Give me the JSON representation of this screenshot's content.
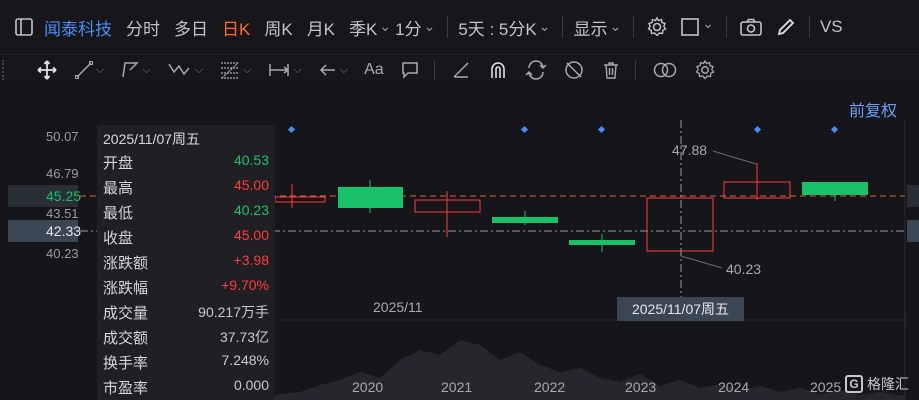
{
  "toolbar": {
    "stock_name": "闻泰科技",
    "periods": [
      "分时",
      "多日",
      "日K",
      "周K",
      "月K",
      "季K"
    ],
    "active_period": "日K",
    "interval": "1分",
    "multi_day": "5天 : 5分K",
    "display": "显示",
    "vs": "VS"
  },
  "drawbar": {
    "text_tool": "Aa",
    "icons": [
      "move-icon",
      "line-icon",
      "polyline-icon",
      "wave-icon",
      "fib-icon",
      "range-icon",
      "arrow-icon",
      "text-icon",
      "comment-icon",
      "ruler-icon",
      "magnet-icon",
      "sync-icon",
      "hide-icon",
      "trash-icon",
      "compare-icon",
      "settings-icon"
    ]
  },
  "chart": {
    "restore_label": "前复权",
    "y_labels": [
      "50.07",
      "46.79",
      "43.51",
      "40.23"
    ],
    "price_tag_current": "45.25",
    "price_tag_cross": "42.33",
    "high_marker": "47.88",
    "low_marker": "40.23",
    "x_labels": [
      "2025/11",
      "2020",
      "2021",
      "2022",
      "2023",
      "2024",
      "2025"
    ],
    "cross_date": "2025/11/07周五",
    "colors": {
      "up": "#ff3b3b",
      "down": "#17c26b",
      "accent": "#ff6a2a",
      "link": "#4a8cf0"
    }
  },
  "info": {
    "date": "2025/11/07周五",
    "rows": [
      {
        "k": "开盘",
        "v": "40.53",
        "c": "green"
      },
      {
        "k": "最高",
        "v": "45.00",
        "c": "red"
      },
      {
        "k": "最低",
        "v": "40.23",
        "c": "green"
      },
      {
        "k": "收盘",
        "v": "45.00",
        "c": "red"
      },
      {
        "k": "涨跌额",
        "v": "+3.98",
        "c": "red"
      },
      {
        "k": "涨跌幅",
        "v": "+9.70%",
        "c": "red"
      },
      {
        "k": "成交量",
        "v": "90.217万手",
        "c": "gray"
      },
      {
        "k": "成交额",
        "v": "37.73亿",
        "c": "gray"
      },
      {
        "k": "换手率",
        "v": "7.248%",
        "c": "gray"
      },
      {
        "k": "市盈率",
        "v": "0.000",
        "c": "gray"
      }
    ]
  },
  "watermark": "格隆汇"
}
